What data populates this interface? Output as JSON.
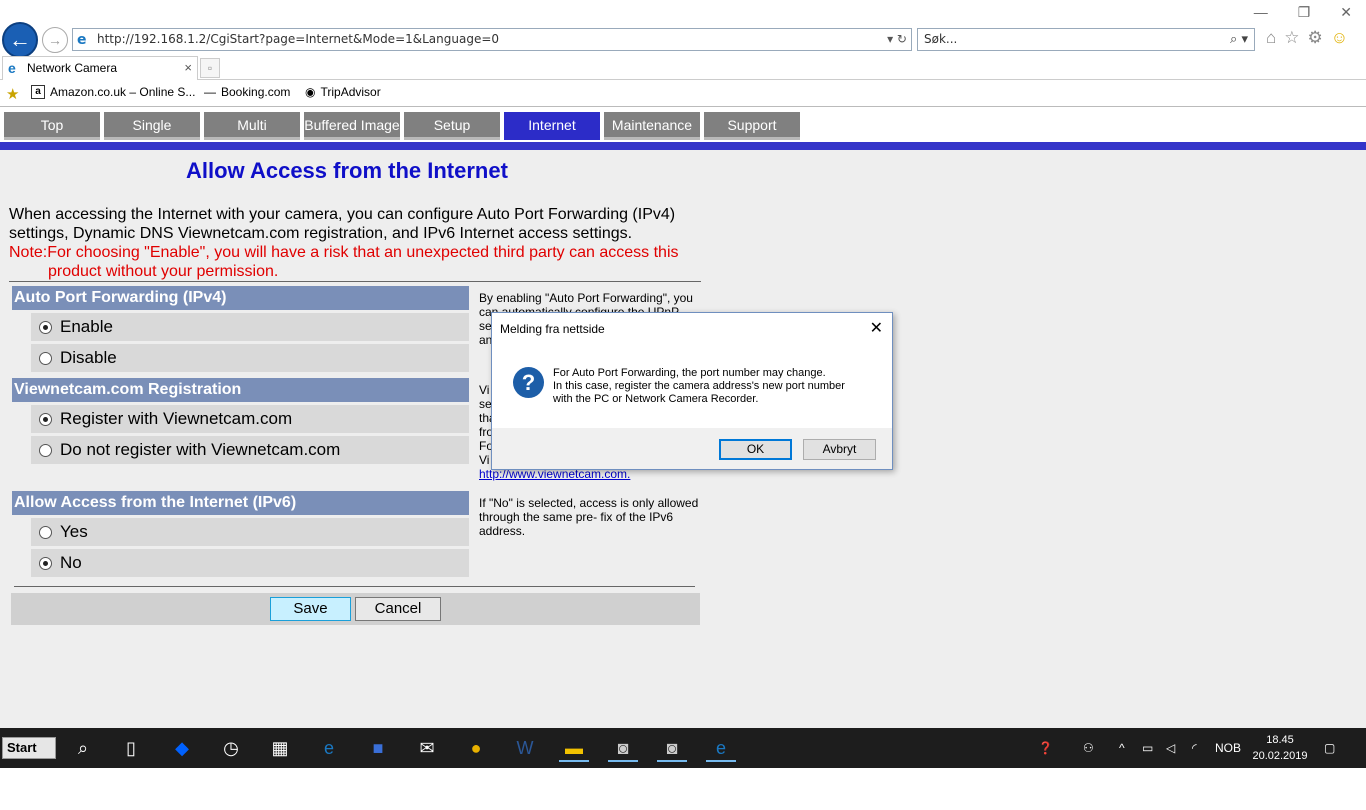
{
  "browser": {
    "url": "http://192.168.1.2/CgiStart?page=Internet&Mode=1&Language=0",
    "search_placeholder": "Søk...",
    "tab_title": "Network Camera",
    "favorites": [
      {
        "label": "Amazon.co.uk – Online S...",
        "icon": "a"
      },
      {
        "label": "Booking.com",
        "icon": "—"
      },
      {
        "label": "TripAdvisor",
        "icon": "◉"
      }
    ]
  },
  "nav": {
    "tabs": [
      {
        "label": "Top"
      },
      {
        "label": "Single"
      },
      {
        "label": "Multi"
      },
      {
        "label": "Buffered Image"
      },
      {
        "label": "Setup"
      },
      {
        "label": "Internet"
      },
      {
        "label": "Maintenance"
      },
      {
        "label": "Support"
      }
    ],
    "active_tab": "Internet"
  },
  "page": {
    "title": "Allow Access from the Internet",
    "intro": "When accessing the Internet with your camera, you can configure Auto Port Forwarding (IPv4) settings, Dynamic DNS Viewnetcam.com registration, and IPv6 Internet access settings.",
    "note_prefix": "Note:For choosing \"Enable\", you will have a risk that an unexpected third party can access this",
    "note_rest": "product without your permission."
  },
  "sections": {
    "port_forwarding": {
      "title": "Auto Port Forwarding (IPv4)",
      "options": [
        "Enable",
        "Disable"
      ],
      "selected": "Enable",
      "help": "By enabling \"Auto Port Forwarding\", you can automatically configure the UPnP settings of the router for port forwarding, and access"
    },
    "viewnetcam": {
      "title": "Viewnetcam.com Registration",
      "options": [
        "Register with Viewnetcam.com",
        "Do not register with Viewnetcam.com"
      ],
      "selected": "Register with Viewnetcam.com",
      "help_lines": [
        "Vi",
        "se",
        "tha",
        "fro",
        "Fo",
        "Vi"
      ],
      "link": "http://www.viewnetcam.com."
    },
    "ipv6": {
      "title": "Allow Access from the Internet (IPv6)",
      "options": [
        "Yes",
        "No"
      ],
      "selected": "No",
      "help": "If \"No\" is selected, access is only allowed through the same pre- fix of the IPv6 address."
    }
  },
  "buttons": {
    "save": "Save",
    "cancel": "Cancel"
  },
  "dialog": {
    "title": "Melding fra nettside",
    "message_lines": [
      "For Auto Port Forwarding, the port number may change.",
      "In this case, register the camera address's new port number",
      "with the PC or Network Camera Recorder."
    ],
    "ok": "OK",
    "cancel": "Avbryt"
  },
  "taskbar": {
    "start": "Start",
    "lang": "NOB",
    "time": "18.45",
    "date": "20.02.2019"
  },
  "colors": {
    "nav_active": "#2c2cc8",
    "nav_inactive": "#808080",
    "section_header": "#7a8fb8",
    "title_blue": "#0f0fc8",
    "note_red": "#e00000"
  }
}
